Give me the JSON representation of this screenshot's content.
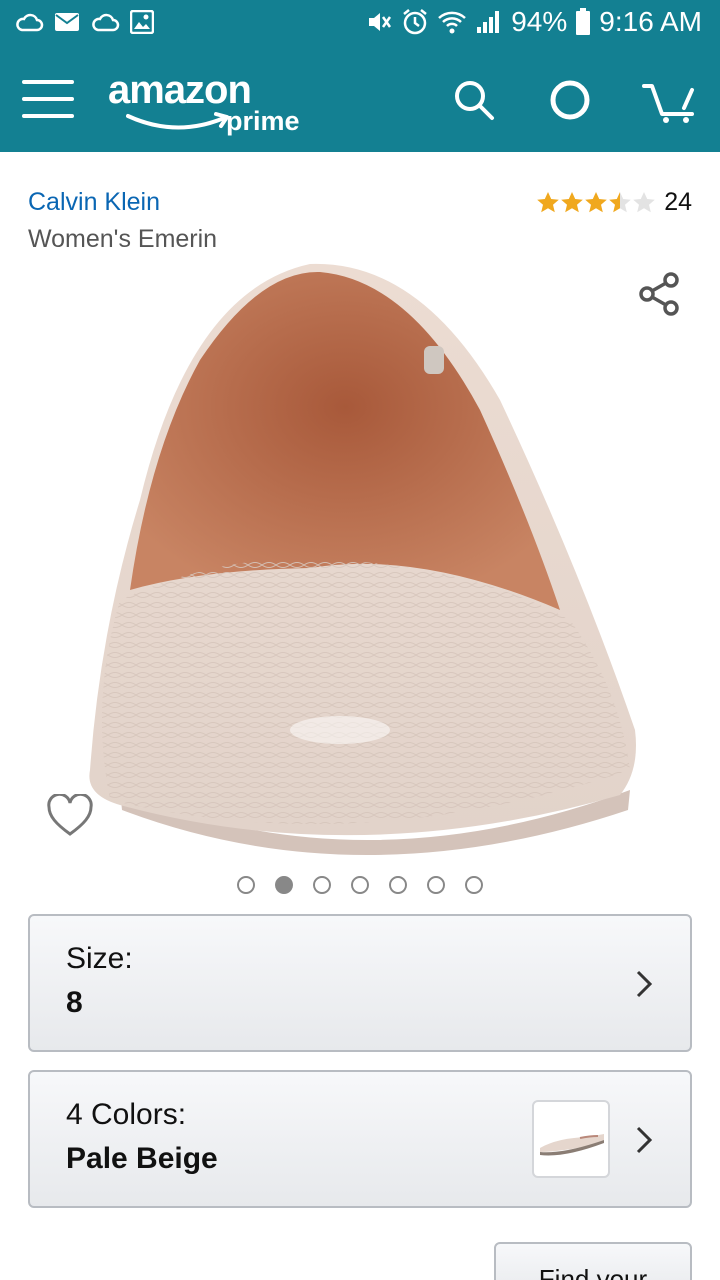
{
  "status_bar": {
    "battery": "94%",
    "time": "9:16 AM",
    "left_icons": [
      "cloud-icon",
      "mail-icon",
      "cloud-icon",
      "image-icon"
    ],
    "right_icons": [
      "mute-icon",
      "alarm-icon",
      "wifi-icon",
      "signal-icon",
      "battery-icon"
    ]
  },
  "app_bar": {
    "logo_text": "amazon",
    "logo_sub": "prime",
    "icons": [
      "menu-icon",
      "search-icon",
      "alexa-icon",
      "cart-icon"
    ],
    "color": "#138092"
  },
  "product": {
    "brand": "Calvin Klein",
    "name": "Women's Emerin",
    "rating": 3.5,
    "rating_count": "24"
  },
  "carousel": {
    "count": 7,
    "active_index": 1
  },
  "size_selector": {
    "label": "Size:",
    "value": "8"
  },
  "color_selector": {
    "label": "4 Colors:",
    "value": "Pale Beige"
  },
  "bottom": {
    "find_button": "Find your",
    "partial_link": ""
  },
  "colors": {
    "brand_link": "#0a66b3",
    "star": "#f0a81e"
  }
}
